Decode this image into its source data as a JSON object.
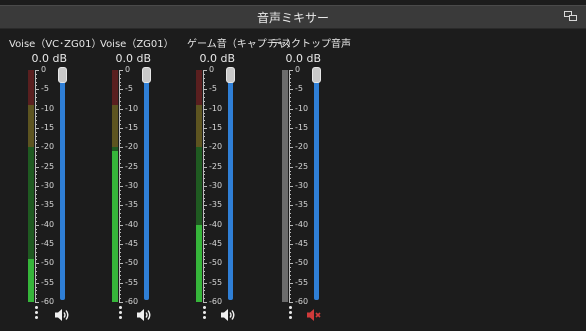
{
  "panel": {
    "title": "音声ミキサー"
  },
  "channels": [
    {
      "name": "Voise（VC･ZG01）",
      "db": "0.0 dB",
      "muted": false
    },
    {
      "name": "Voise（ZG01）",
      "db": "0.0 dB",
      "muted": false
    },
    {
      "name": "ゲーム音（キャプチャ）",
      "db": "0.0 dB",
      "muted": false
    },
    {
      "name": "デスクトップ音声",
      "db": "0.0 dB",
      "muted": true
    }
  ],
  "scale_labels": [
    "0",
    "-5",
    "-10",
    "-15",
    "-20",
    "-25",
    "-30",
    "-35",
    "-40",
    "-45",
    "-50",
    "-55",
    "-60"
  ],
  "colors": {
    "green": "#36b53a",
    "green_dim": "#1f5a21",
    "yellow": "#b8a63a",
    "yellow_dim": "#5d5420",
    "red": "#b03636",
    "red_dim": "#5a1f1f",
    "gray_meter": "#6b6b6b",
    "fader": "#2f7fd6",
    "mute_red": "#d13a3a"
  },
  "icons": {
    "undock": "undock-icon",
    "menu": "kebab-menu-icon",
    "speaker": "speaker-icon",
    "muted": "speaker-muted-icon"
  }
}
